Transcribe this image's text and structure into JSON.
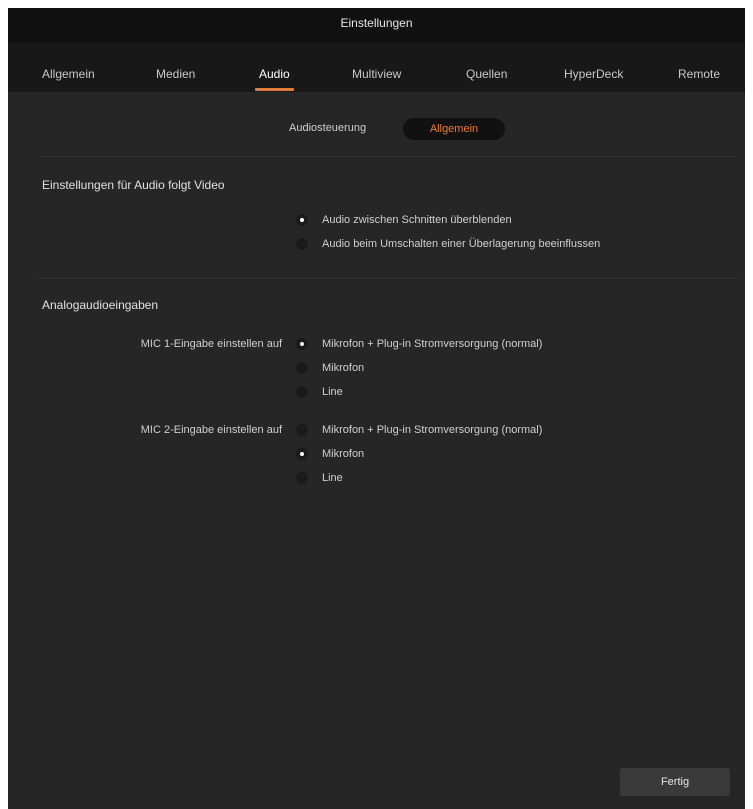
{
  "window": {
    "title": "Einstellungen"
  },
  "tabs": [
    {
      "label": "Allgemein"
    },
    {
      "label": "Medien"
    },
    {
      "label": "Audio",
      "active": true
    },
    {
      "label": "Multiview"
    },
    {
      "label": "Quellen"
    },
    {
      "label": "HyperDeck"
    },
    {
      "label": "Remote"
    }
  ],
  "subnav": {
    "label": "Audiosteuerung",
    "active_label": "Allgemein"
  },
  "audio_follow_video": {
    "title": "Einstellungen für Audio folgt Video",
    "options": [
      {
        "label": "Audio zwischen Schnitten überblenden",
        "selected": true
      },
      {
        "label": "Audio beim Umschalten einer Überlagerung beeinflussen",
        "selected": false
      }
    ]
  },
  "analog_inputs": {
    "title": "Analogaudioeingaben",
    "mic1": {
      "label": "MIC 1-Eingabe einstellen auf",
      "options": [
        {
          "label": "Mikrofon + Plug-in Stromversorgung (normal)",
          "selected": true
        },
        {
          "label": "Mikrofon",
          "selected": false
        },
        {
          "label": "Line",
          "selected": false
        }
      ]
    },
    "mic2": {
      "label": "MIC 2-Eingabe einstellen auf",
      "options": [
        {
          "label": "Mikrofon + Plug-in Stromversorgung (normal)",
          "selected": false
        },
        {
          "label": "Mikrofon",
          "selected": true
        },
        {
          "label": "Line",
          "selected": false
        }
      ]
    }
  },
  "footer": {
    "done_label": "Fertig"
  },
  "colors": {
    "accent": "#e07b3b",
    "background": "#262626",
    "tabbar": "#181818"
  }
}
